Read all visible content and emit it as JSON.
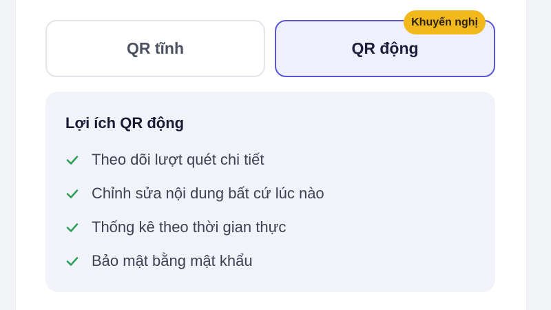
{
  "qr_type": {
    "static_label": "QR tĩnh",
    "dynamic_label": "QR động",
    "recommended_badge": "Khuyến nghị",
    "selected": "dynamic"
  },
  "benefits": {
    "title": "Lợi ích QR động",
    "items": [
      {
        "icon": "check-icon",
        "label": "Theo dõi lượt quét chi tiết"
      },
      {
        "icon": "check-icon",
        "label": "Chỉnh sửa nội dung bất cứ lúc nào"
      },
      {
        "icon": "check-icon",
        "label": "Thống kê theo thời gian thực"
      },
      {
        "icon": "check-icon",
        "label": "Bảo mật bằng mật khẩu"
      }
    ]
  },
  "colors": {
    "accent": "#5a55d6",
    "badge": "#f2b81c",
    "check": "#2e9e58"
  }
}
